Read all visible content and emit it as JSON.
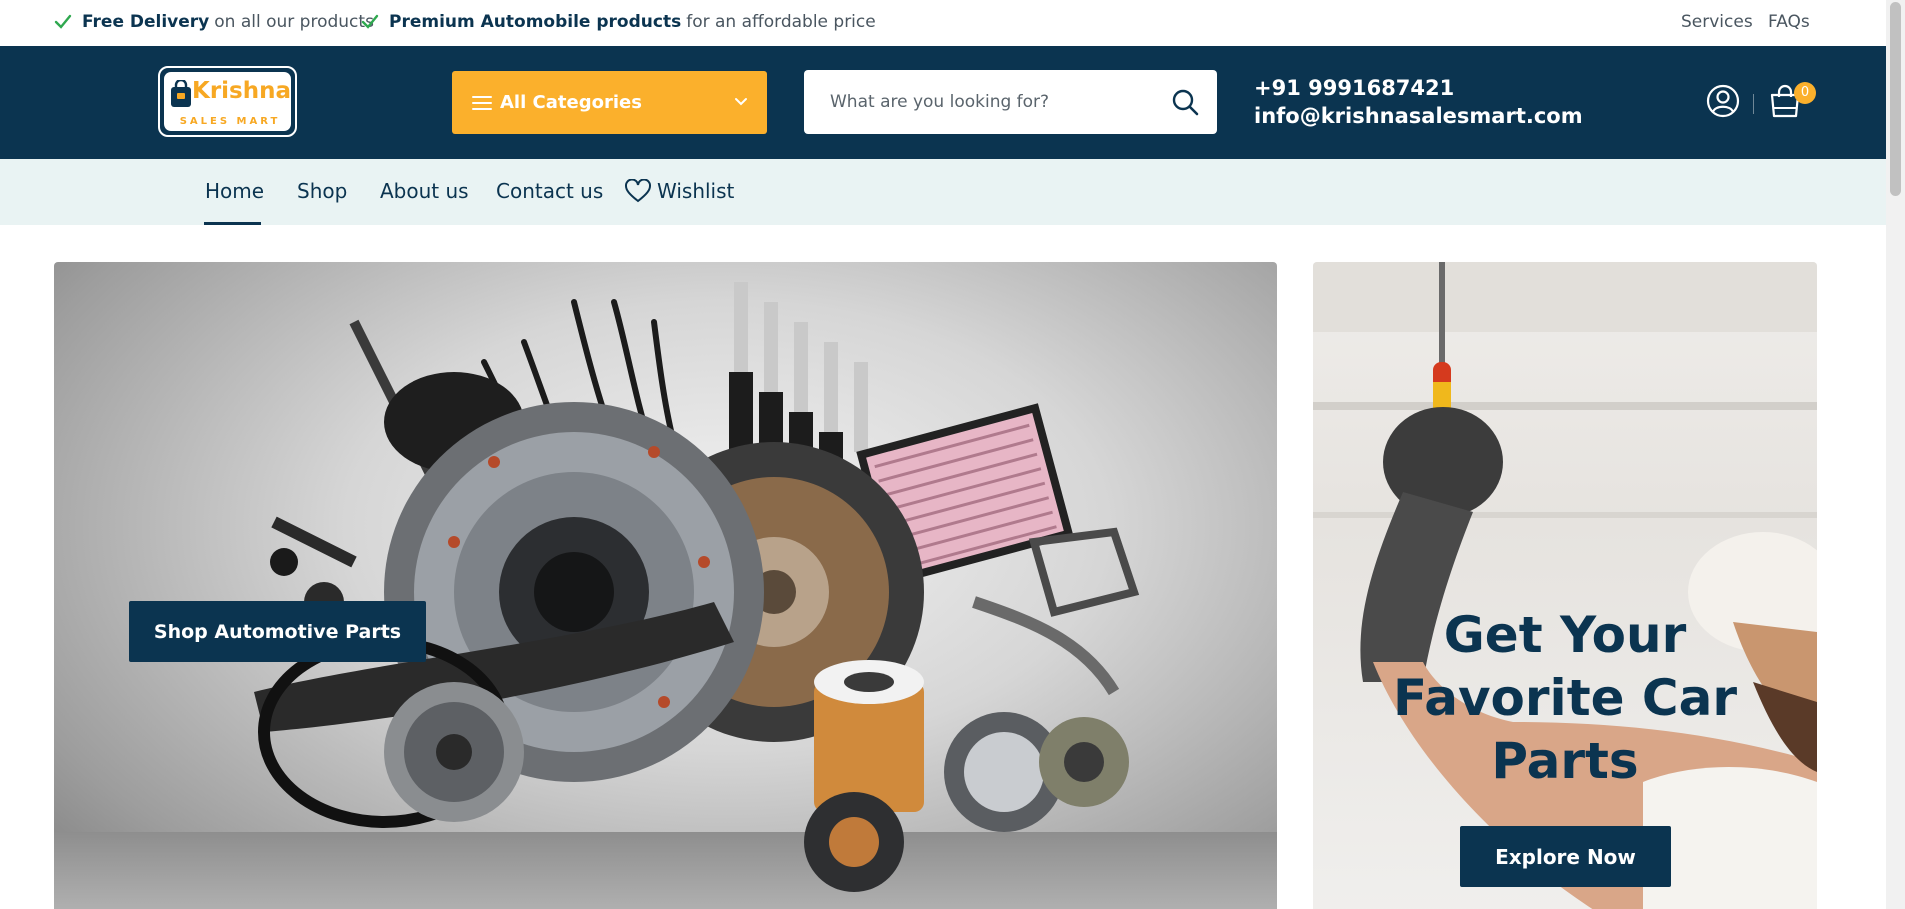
{
  "topbar": {
    "features": [
      {
        "bold": "Free Delivery",
        "text": "on all our products"
      },
      {
        "bold": "Premium Automobile products",
        "text": "for an affordable price"
      }
    ],
    "links": [
      "Services",
      "FAQs"
    ]
  },
  "header": {
    "logo": {
      "word": "Krishna",
      "sub": "SALES MART"
    },
    "categories_label": "All Categories",
    "search_placeholder": "What are you looking for?",
    "phone": "+91 9991687421",
    "email": "info@krishnasalesmart.com",
    "cart_count": "0"
  },
  "nav": {
    "items": [
      "Home",
      "Shop",
      "About us",
      "Contact us"
    ],
    "wishlist": "Wishlist",
    "active": "Home"
  },
  "hero": {
    "main_button": "Shop Automotive Parts",
    "side_headline": "Get Your Favorite Car Parts",
    "side_button": "Explore Now"
  },
  "colors": {
    "brand_dark": "#0b3450",
    "accent": "#fbb02c",
    "nav_bg": "#e9f3f3"
  }
}
